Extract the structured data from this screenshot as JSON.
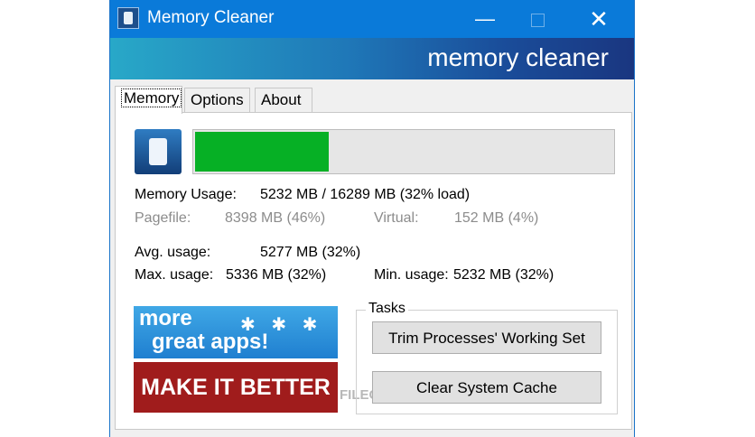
{
  "window": {
    "title": "Memory Cleaner",
    "minimize_glyph": "—",
    "close_glyph": "✕"
  },
  "banner": {
    "text": "memory cleaner"
  },
  "tabs": [
    {
      "label": "Memory",
      "active": true
    },
    {
      "label": "Options",
      "active": false
    },
    {
      "label": "About",
      "active": false
    }
  ],
  "memory": {
    "progress_fraction": 0.32,
    "usage_label": "Memory Usage:",
    "usage_value": "5232 MB / 16289 MB  (32% load)",
    "pagefile_label": "Pagefile:",
    "pagefile_value": "8398 MB (46%)",
    "virtual_label": "Virtual:",
    "virtual_value": "152 MB (4%)",
    "avg_label": "Avg. usage:",
    "avg_value": "5277 MB (32%)",
    "max_label": "Max. usage:",
    "max_value": "5336 MB (32%)",
    "min_label": "Min. usage:",
    "min_value": "5232 MB (32%)"
  },
  "promos": {
    "more_line1": "more",
    "more_line2": "great apps!",
    "make_better": "MAKE IT BETTER"
  },
  "tasks": {
    "legend": "Tasks",
    "trim_button": "Trim Processes' Working Set",
    "clear_button": "Clear System Cache"
  },
  "watermark": {
    "text": "FILECR"
  },
  "colors": {
    "titlebar": "#0a7ad9",
    "progress_fill": "#06b025",
    "promo_red": "#a01c1c"
  }
}
